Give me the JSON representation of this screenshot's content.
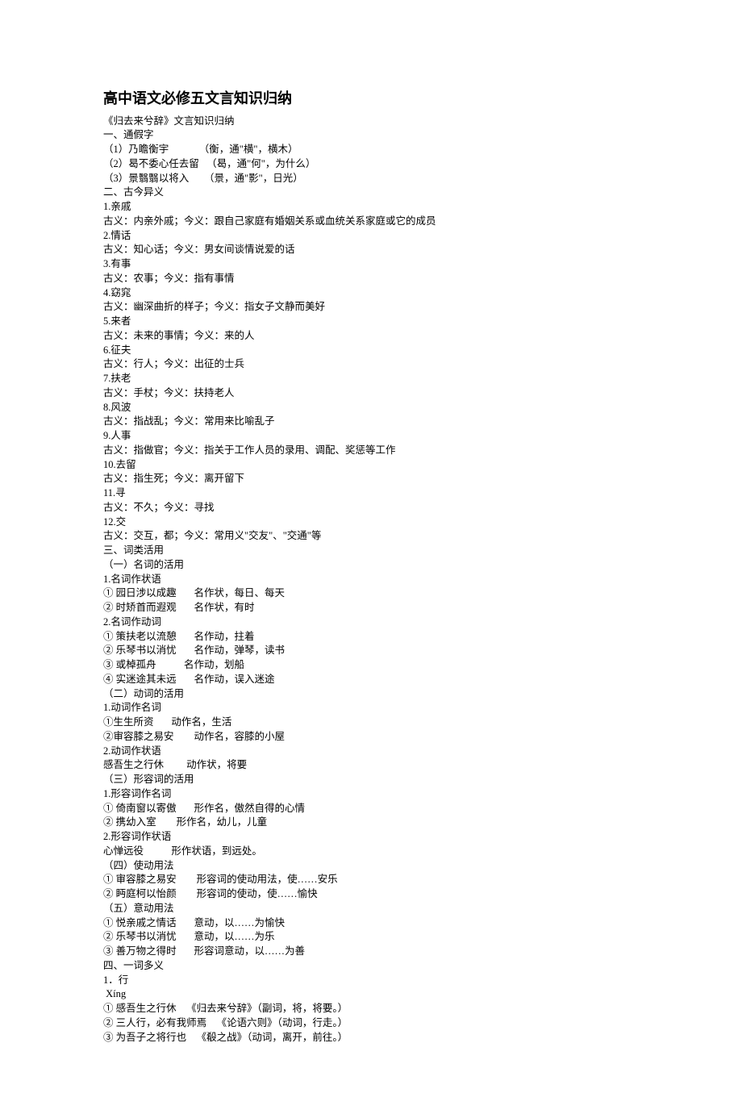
{
  "title": "高中语文必修五文言知识归纳",
  "lines": [
    "《归去来兮辞》文言知识归纳",
    "一、通假字",
    "（1）乃瞻衡宇            （衡，通\"横\"，横木）",
    "（2）曷不委心任去留   （曷，通\"何\"，为什么）",
    "（3）景翳翳以将入      （景，通\"影\"，日光）",
    "二、古今异义",
    "1.亲戚",
    "古义：内亲外戚；今义：跟自己家庭有婚姻关系或血统关系家庭或它的成员",
    "2.情话",
    "古义：知心话；今义：男女间谈情说爱的话",
    "3.有事",
    "古义：农事；今义：指有事情",
    "4.窈窕",
    "古义：幽深曲折的样子；今义：指女子文静而美好",
    "5.来者",
    "古义：未来的事情；今义：来的人",
    "6.征夫",
    "古义：行人；今义：出征的士兵",
    "7.扶老",
    "古义：手杖；今义：扶持老人",
    "8.风波",
    "古义：指战乱；今义：常用来比喻乱子",
    "9.人事",
    "古义：指做官；今义：指关于工作人员的录用、调配、奖惩等工作",
    "10.去留",
    "古义：指生死；今义：离开留下",
    "11.寻",
    "古义：不久；今义：寻找",
    "12.交",
    "古义：交互，都；今义：常用义\"交友\"、\"交通\"等",
    "三、词类活用",
    "（一）名词的活用",
    "1.名词作状语",
    "① 园日涉以成趣       名作状，每日、每天",
    "② 时矫首而遐观       名作状，有时",
    "2.名词作动词",
    "① 策扶老以流憩       名作动，拄着",
    "② 乐琴书以消忧       名作动，弹琴，读书",
    "③ 或棹孤舟           名作动，划船",
    "④ 实迷途其未远       名作动，误入迷途",
    "（二）动词的活用",
    "1.动词作名词",
    "①生生所资       动作名，生活",
    "②审容膝之易安        动作名，容膝的小屋",
    "2.动词作状语",
    "感吾生之行休         动作状，将要",
    "（三）形容词的活用",
    "1.形容词作名词",
    "① 倚南窗以寄傲       形作名，傲然自得的心情",
    "② 携幼入室        形作名，幼儿，儿童",
    "2.形容词作状语",
    "心惮远役           形作状语，到远处。",
    "（四）使动用法",
    "① 审容膝之易安        形容词的使动用法，使……安乐",
    "② 眄庭柯以怡颜        形容词的使动，使……愉快",
    "（五）意动用法",
    "① 悦亲戚之情话       意动，以……为愉快",
    "② 乐琴书以消忧       意动，以……为乐",
    "③ 善万物之得时       形容词意动，以……为善",
    "四、一词多义",
    "1．行",
    " Xíng",
    "① 感吾生之行休    《归去来兮辞》（副词，将，将要。）",
    "② 三人行，必有我师焉    《论语六则》（动词，行走。）",
    "③ 为吾子之将行也    《殽之战》（动词，离开，前往。）"
  ]
}
